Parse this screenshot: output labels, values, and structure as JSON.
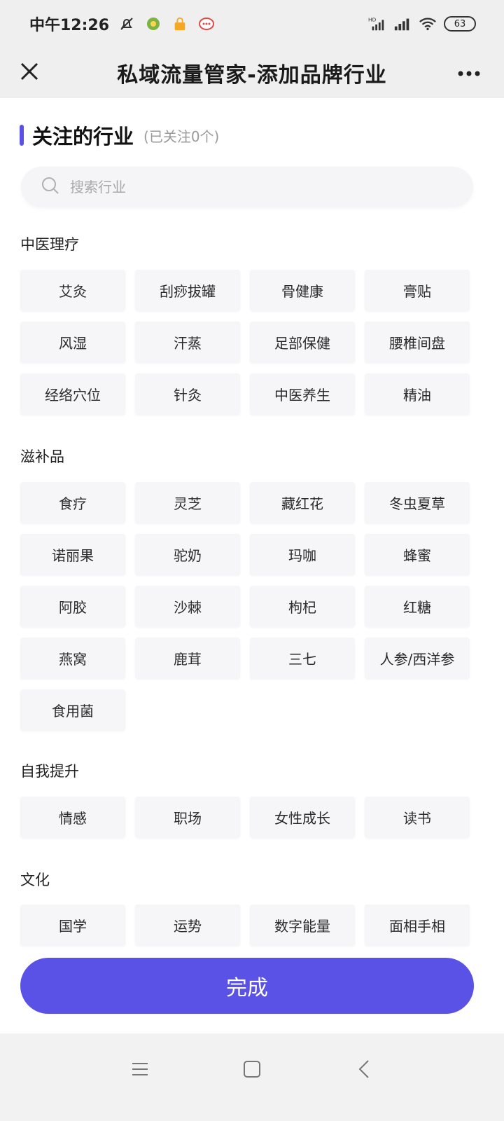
{
  "status_bar": {
    "time": "中午12:26",
    "battery": "63"
  },
  "header": {
    "title": "私域流量管家-添加品牌行业"
  },
  "section": {
    "title": "关注的行业",
    "subtitle": "(已关注0个)"
  },
  "search": {
    "placeholder": "搜索行业"
  },
  "categories": [
    {
      "name": "中医理疗",
      "items": [
        "艾灸",
        "刮痧拔罐",
        "骨健康",
        "膏贴",
        "风湿",
        "汗蒸",
        "足部保健",
        "腰椎间盘",
        "经络穴位",
        "针灸",
        "中医养生",
        "精油"
      ]
    },
    {
      "name": "滋补品",
      "items": [
        "食疗",
        "灵芝",
        "藏红花",
        "冬虫夏草",
        "诺丽果",
        "驼奶",
        "玛咖",
        "蜂蜜",
        "阿胶",
        "沙棘",
        "枸杞",
        "红糖",
        "燕窝",
        "鹿茸",
        "三七",
        "人参/西洋参",
        "食用菌"
      ]
    },
    {
      "name": "自我提升",
      "items": [
        "情感",
        "职场",
        "女性成长",
        "读书"
      ]
    },
    {
      "name": "文化",
      "items": [
        "国学",
        "运势",
        "数字能量",
        "面相手相"
      ]
    }
  ],
  "footer": {
    "done_label": "完成"
  },
  "colors": {
    "accent": "#5a52e6",
    "chip_bg": "#f6f6f8",
    "header_bg": "#efefef"
  },
  "icons": {
    "status": [
      "mute-bell-icon",
      "app-notification-icon",
      "lock-app-icon",
      "chat-app-icon",
      "hd-signal-icon",
      "signal-icon",
      "wifi-icon",
      "battery-icon"
    ],
    "header": [
      "close-icon",
      "more-icon"
    ],
    "search": "search-icon",
    "nav": [
      "menu-icon",
      "home-icon",
      "back-icon"
    ]
  }
}
